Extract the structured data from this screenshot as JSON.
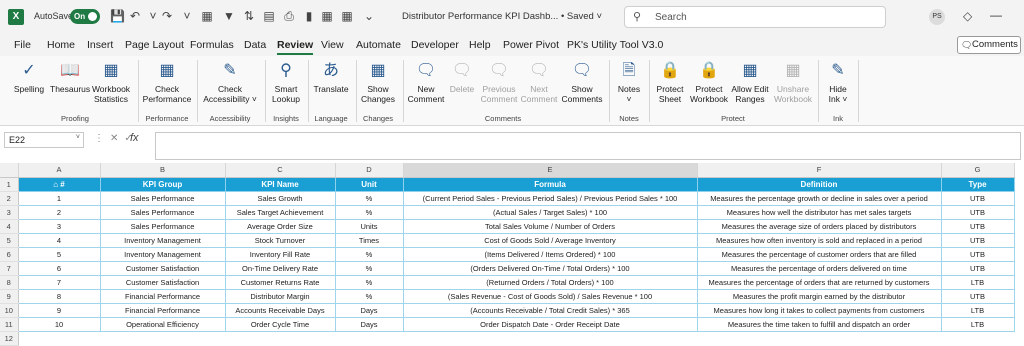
{
  "title_bar": {
    "autosave_label": "AutoSave",
    "autosave_state": "On",
    "doc_title": "Distributor Performance KPI Dashb...",
    "saved_status": "• Saved",
    "search_placeholder": "Search",
    "user_initials": "PS"
  },
  "tabs": [
    "File",
    "Home",
    "Insert",
    "Page Layout",
    "Formulas",
    "Data",
    "Review",
    "View",
    "Automate",
    "Developer",
    "Help",
    "Power Pivot",
    "PK's Utility Tool V3.0"
  ],
  "active_tab": "Review",
  "comments_button": "Comments",
  "ribbon": {
    "spelling": "Spelling",
    "thesaurus": "Thesaurus",
    "workbook_statistics_1": "Workbook",
    "workbook_statistics_2": "Statistics",
    "proofing": "Proofing",
    "check_performance_1": "Check",
    "check_performance_2": "Performance",
    "performance": "Performance",
    "check_accessibility_1": "Check",
    "check_accessibility_2": "Accessibility",
    "accessibility": "Accessibility",
    "smart_lookup_1": "Smart",
    "smart_lookup_2": "Lookup",
    "insights": "Insights",
    "translate": "Translate",
    "language": "Language",
    "show_changes_1": "Show",
    "show_changes_2": "Changes",
    "changes": "Changes",
    "new_comment_1": "New",
    "new_comment_2": "Comment",
    "delete": "Delete",
    "previous_comment_1": "Previous",
    "previous_comment_2": "Comment",
    "next_comment_1": "Next",
    "next_comment_2": "Comment",
    "show_comments_1": "Show",
    "show_comments_2": "Comments",
    "comments_group": "Comments",
    "notes": "Notes",
    "notes_group": "Notes",
    "protect_sheet_1": "Protect",
    "protect_sheet_2": "Sheet",
    "protect_workbook_1": "Protect",
    "protect_workbook_2": "Workbook",
    "allow_edit_ranges_1": "Allow Edit",
    "allow_edit_ranges_2": "Ranges",
    "unshare_workbook_1": "Unshare",
    "unshare_workbook_2": "Workbook",
    "protect_group": "Protect",
    "hide_ink_1": "Hide",
    "hide_ink_2": "Ink",
    "ink_group": "Ink"
  },
  "formula_bar": {
    "name_box": "E22",
    "fx": "fx"
  },
  "columns": [
    "A",
    "B",
    "C",
    "D",
    "E",
    "F",
    "G"
  ],
  "header_row": [
    "#",
    "KPI Group",
    "KPI Name",
    "Unit",
    "Formula",
    "Definition",
    "Type"
  ],
  "rows": [
    [
      "1",
      "Sales Performance",
      "Sales Growth",
      "%",
      "(Current Period Sales - Previous Period Sales) / Previous Period Sales * 100",
      "Measures the percentage growth or decline in sales over a period",
      "UTB"
    ],
    [
      "2",
      "Sales Performance",
      "Sales Target Achievement",
      "%",
      "(Actual Sales / Target Sales) * 100",
      "Measures how well the distributor has met sales targets",
      "UTB"
    ],
    [
      "3",
      "Sales Performance",
      "Average Order Size",
      "Units",
      "Total Sales Volume / Number of Orders",
      "Measures the average size of orders placed by distributors",
      "UTB"
    ],
    [
      "4",
      "Inventory Management",
      "Stock Turnover",
      "Times",
      "Cost of Goods Sold / Average Inventory",
      "Measures how often inventory is sold and replaced in a period",
      "UTB"
    ],
    [
      "5",
      "Inventory Management",
      "Inventory Fill Rate",
      "%",
      "(Items Delivered / Items Ordered) * 100",
      "Measures the percentage of customer orders that are filled",
      "UTB"
    ],
    [
      "6",
      "Customer Satisfaction",
      "On-Time Delivery Rate",
      "%",
      "(Orders Delivered On-Time / Total Orders) * 100",
      "Measures the percentage of orders delivered on time",
      "UTB"
    ],
    [
      "7",
      "Customer Satisfaction",
      "Customer Returns Rate",
      "%",
      "(Returned Orders / Total Orders) * 100",
      "Measures the percentage of orders that are returned by customers",
      "LTB"
    ],
    [
      "8",
      "Financial Performance",
      "Distributor Margin",
      "%",
      "(Sales Revenue - Cost of Goods Sold) / Sales Revenue * 100",
      "Measures the profit margin earned by the distributor",
      "UTB"
    ],
    [
      "9",
      "Financial Performance",
      "Accounts Receivable Days",
      "Days",
      "(Accounts Receivable / Total Credit Sales) * 365",
      "Measures how long it takes to collect payments from customers",
      "LTB"
    ],
    [
      "10",
      "Operational Efficiency",
      "Order Cycle Time",
      "Days",
      "Order Dispatch Date - Order Receipt Date",
      "Measures the time taken to fulfill and dispatch an order",
      "LTB"
    ]
  ],
  "row_numbers": [
    "1",
    "2",
    "3",
    "4",
    "5",
    "6",
    "7",
    "8",
    "9",
    "10",
    "11",
    "12"
  ],
  "colors": {
    "excel_green": "#1f7a43",
    "header_blue": "#1a9fd5",
    "border_blue": "#9ed4ec"
  }
}
